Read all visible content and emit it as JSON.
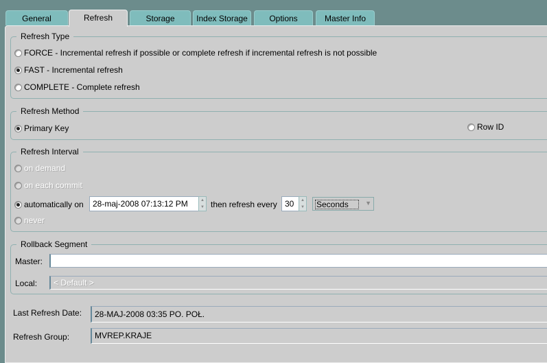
{
  "tabs": [
    "General",
    "Refresh",
    "Storage",
    "Index Storage",
    "Options",
    "Master Info"
  ],
  "selected_tab": "Refresh",
  "refresh_type": {
    "title": "Refresh Type",
    "options": [
      "FORCE - Incremental refresh if possible or complete refresh if incremental refresh is not possible",
      "FAST - Incremental refresh",
      "COMPLETE - Complete refresh"
    ],
    "selected": "FAST - Incremental refresh"
  },
  "refresh_method": {
    "title": "Refresh Method",
    "primary_key": "Primary Key",
    "row_id": "Row ID",
    "selected": "Primary Key"
  },
  "refresh_interval": {
    "title": "Refresh Interval",
    "on_demand": "on demand",
    "on_commit": "on each commit",
    "automatically": "automatically on",
    "date_value": "28-maj-2008 07:13:12 PM",
    "then_label": "then refresh every",
    "every_value": "30",
    "unit": "Seconds",
    "never": "never",
    "selected": "automatically on"
  },
  "rollback": {
    "title": "Rollback Segment",
    "master_label": "Master:",
    "master_value": "",
    "local_label": "Local:",
    "local_value": "< Default >"
  },
  "last_refresh": {
    "label": "Last Refresh Date:",
    "value": "28-MAJ-2008 03:35 PO. POŁ."
  },
  "refresh_group": {
    "label": "Refresh Group:",
    "value": "MVREP.KRAJE"
  }
}
